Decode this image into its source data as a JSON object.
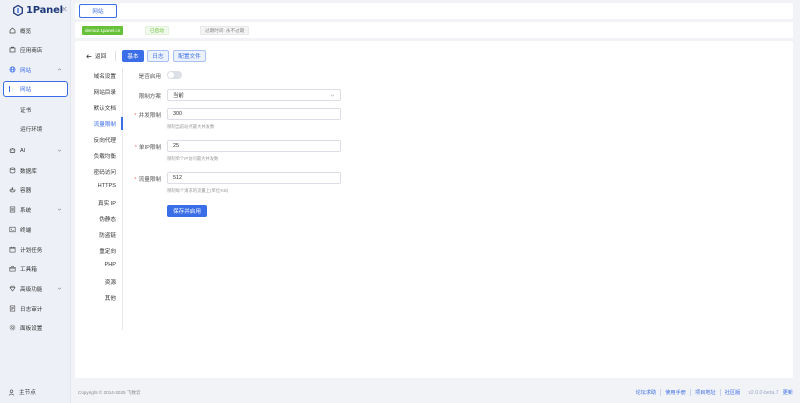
{
  "app": {
    "logo_text": "1Panel"
  },
  "sidebar": {
    "items": [
      {
        "label": "概览",
        "icon": "home-icon"
      },
      {
        "label": "应用商店",
        "icon": "store-icon"
      },
      {
        "label": "网站",
        "icon": "globe-icon",
        "expanded": true
      },
      {
        "label": "AI",
        "icon": "ai-icon"
      },
      {
        "label": "数据库",
        "icon": "database-icon"
      },
      {
        "label": "容器",
        "icon": "container-icon"
      },
      {
        "label": "系统",
        "icon": "system-icon"
      },
      {
        "label": "终端",
        "icon": "terminal-icon"
      },
      {
        "label": "计划任务",
        "icon": "calendar-icon"
      },
      {
        "label": "工具箱",
        "icon": "toolbox-icon"
      },
      {
        "label": "高级功能",
        "icon": "diamond-icon"
      },
      {
        "label": "日志审计",
        "icon": "log-icon"
      },
      {
        "label": "面板设置",
        "icon": "settings-icon"
      }
    ],
    "website_sub": [
      {
        "label": "网站",
        "active": true
      },
      {
        "label": "证书"
      },
      {
        "label": "运行环境"
      }
    ],
    "host_label": "主节点"
  },
  "tabbar": {
    "active_tab": "网站"
  },
  "infobar": {
    "domain": "demo2.1panel.cn",
    "status": "已启动",
    "expire": "过期时间: 永不过期"
  },
  "main": {
    "back_label": "返回",
    "tabs": [
      "基本",
      "日志",
      "配置文件"
    ],
    "submenu": [
      "域名设置",
      "网站目录",
      "默认文档",
      "流量限制",
      "反向代理",
      "负载均衡",
      "密码访问",
      "HTTPS",
      "真实 IP",
      "伪静态",
      "防盗链",
      "重定向",
      "PHP",
      "资源",
      "其他"
    ],
    "active_submenu": "流量限制",
    "form": {
      "enable_label": "是否启用",
      "enabled": false,
      "scheme_label": "限制方案",
      "scheme_value": "当前",
      "concurrency_label": "并发限制",
      "concurrency_value": "300",
      "concurrency_help": "限制当前站点最大并发数",
      "ip_label": "单IP限制",
      "ip_value": "25",
      "ip_help": "限制单个IP访问最大并发数",
      "rate_label": "流量限制",
      "rate_value": "512",
      "rate_help": "限制每个请求的流量上(单位:KB)",
      "save_label": "保存并启用"
    }
  },
  "footer": {
    "copyright": "Copyright © 2014-2025 飞致云",
    "links": [
      "论坛求助",
      "使用手册",
      "项目地址",
      "社区版"
    ],
    "version": "v2.0.0-beta.7",
    "update": "更新"
  },
  "colors": {
    "accent": "#3a6de8",
    "success": "#67c23a",
    "danger": "#f56c6c"
  }
}
